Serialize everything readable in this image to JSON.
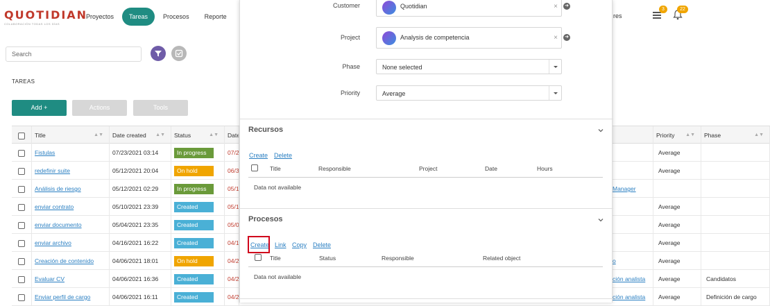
{
  "app": {
    "logo_text": "QUOTIDIAN",
    "logo_tagline": "COLABORACIÓN TODAS LOS DÍAS",
    "nav": [
      "Proyectos",
      "Tareas",
      "Procesos",
      "Reporte"
    ],
    "nav_active": "Tareas",
    "nav_right_fragment": "res",
    "badge_list": "3",
    "badge_bell": "22"
  },
  "search": {
    "placeholder": "Search"
  },
  "page": {
    "section_title": "TAREAS",
    "btn_add": "Add +",
    "btn_actions": "Actions",
    "btn_tools": "Tools"
  },
  "table": {
    "headers": {
      "title": "Title",
      "date_created": "Date created",
      "status": "Status",
      "date_col": "Date",
      "priority": "Priority",
      "phase": "Phase"
    },
    "rows": [
      {
        "title": "Fistulas",
        "date": "07/23/2021 03:14",
        "status": "In progress",
        "status_color": "#6a9a3a",
        "due": "07/2",
        "right": "",
        "priority": "Average",
        "phase": ""
      },
      {
        "title": "redefinir suite",
        "date": "05/12/2021 20:04",
        "status": "On hold",
        "status_color": "#f0a500",
        "due": "06/3",
        "right": "",
        "priority": "Average",
        "phase": ""
      },
      {
        "title": "Análisis de riesgo",
        "date": "05/12/2021 02:29",
        "status": "In progress",
        "status_color": "#6a9a3a",
        "due": "05/1",
        "right": "Manager",
        "priority": "",
        "phase": ""
      },
      {
        "title": "enviar contrato",
        "date": "05/10/2021 23:39",
        "status": "Created",
        "status_color": "#4ab0d6",
        "due": "05/1",
        "right": "",
        "priority": "Average",
        "phase": ""
      },
      {
        "title": "enviar documento",
        "date": "05/04/2021 23:35",
        "status": "Created",
        "status_color": "#4ab0d6",
        "due": "05/0",
        "right": "",
        "priority": "Average",
        "phase": ""
      },
      {
        "title": "enviar archivo",
        "date": "04/16/2021 16:22",
        "status": "Created",
        "status_color": "#4ab0d6",
        "due": "04/1",
        "right": "",
        "priority": "Average",
        "phase": ""
      },
      {
        "title": "Creación de contenido",
        "date": "04/06/2021 18:01",
        "status": "On hold",
        "status_color": "#f0a500",
        "due": "04/2",
        "right": "o",
        "priority": "Average",
        "phase": ""
      },
      {
        "title": "Evaluar CV",
        "date": "04/06/2021 16:36",
        "status": "Created",
        "status_color": "#4ab0d6",
        "due": "04/2",
        "right": "ción analista",
        "priority": "Average",
        "phase": "Candidatos"
      },
      {
        "title": "Enviar perfil de cargo",
        "date": "04/06/2021 16:11",
        "status": "Created",
        "status_color": "#4ab0d6",
        "due": "04/2",
        "right": "ción analista",
        "priority": "Average",
        "phase": "Definición de cargo"
      }
    ]
  },
  "modal": {
    "customer_label": "Customer",
    "customer_value": "Quotidian",
    "project_label": "Project",
    "project_value": "Analysis de competencia",
    "phase_label": "Phase",
    "phase_value": "None selected",
    "priority_label": "Priority",
    "priority_value": "Average",
    "recursos": {
      "title": "Recursos",
      "actions": [
        "Create",
        "Delete"
      ],
      "columns": [
        "Title",
        "Responsible",
        "Project",
        "Date",
        "Hours"
      ],
      "empty": "Data not available"
    },
    "procesos": {
      "title": "Procesos",
      "actions": [
        "Create",
        "Link",
        "Copy",
        "Delete"
      ],
      "columns": [
        "Title",
        "Status",
        "Responsible",
        "Related object"
      ],
      "empty": "Data not available"
    }
  },
  "colors": {
    "accent": "#1f8c82",
    "link": "#2a7fc2",
    "highlight": "#d0021b"
  }
}
